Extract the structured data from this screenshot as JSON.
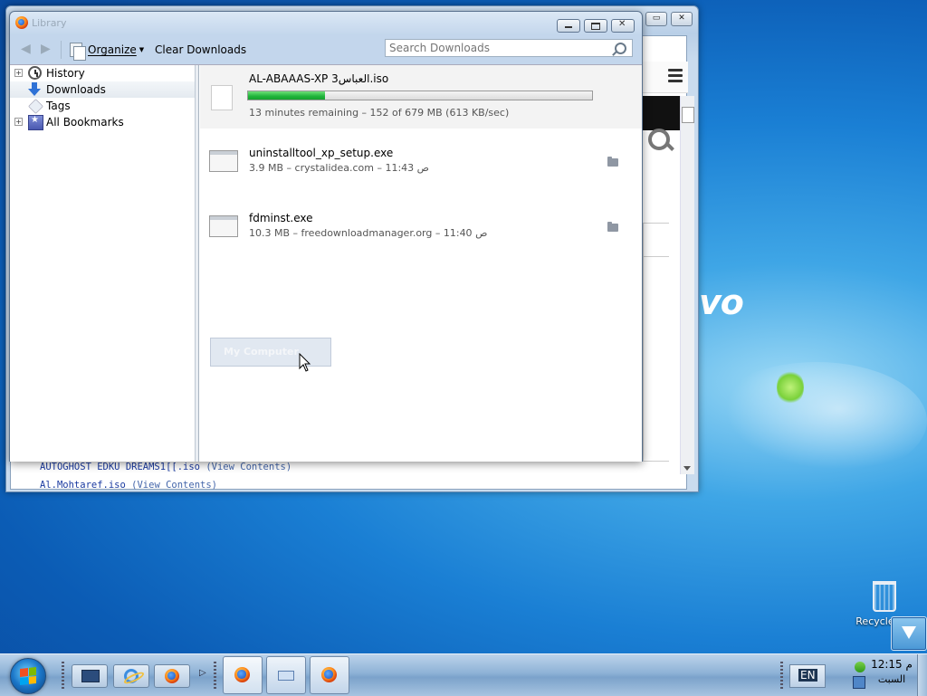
{
  "desktop": {
    "wallpaper_text": "vo",
    "recycle_bin_label": "Recycle Bin"
  },
  "background_window": {
    "file_rows": [
      {
        "name": "AUTOGHOST EDKU DREAMS1[[.iso",
        "action": "(View Contents)"
      },
      {
        "name": "Al.Mohtaref.iso",
        "action": "(View Contents)"
      }
    ]
  },
  "library": {
    "title": "Library",
    "toolbar": {
      "organize_label": "Organize",
      "clear_label": "Clear Downloads"
    },
    "search": {
      "placeholder": "Search Downloads"
    },
    "tree": [
      {
        "label": "History",
        "icon": "clock-icon",
        "expandable": true
      },
      {
        "label": "Downloads",
        "icon": "download-arrow-icon",
        "expandable": false,
        "selected": true
      },
      {
        "label": "Tags",
        "icon": "tag-icon",
        "expandable": false
      },
      {
        "label": "All Bookmarks",
        "icon": "bookmarks-icon",
        "expandable": true
      }
    ],
    "downloads": [
      {
        "name": "AL-ABAAAS-XP 3العباس.iso",
        "status": "13 minutes remaining – 152 of 679 MB (613 KB/sec)",
        "in_progress": true,
        "progress_fraction": 0.224
      },
      {
        "name": "uninstalltool_xp_setup.exe",
        "status": "3.9 MB – crystalidea.com – 11:43 ص",
        "in_progress": false
      },
      {
        "name": "fdminst.exe",
        "status": "10.3 MB – freedownloadmanager.org – 11:40 ص",
        "in_progress": false
      }
    ],
    "drag_ghost_text": "My Computer"
  },
  "taskbar": {
    "language": "EN",
    "clock_time": "12:15 م",
    "clock_day": "السبت"
  },
  "colors": {
    "progress_fill": "#1fb43a",
    "desktop_blue": "#1a7fd4"
  }
}
